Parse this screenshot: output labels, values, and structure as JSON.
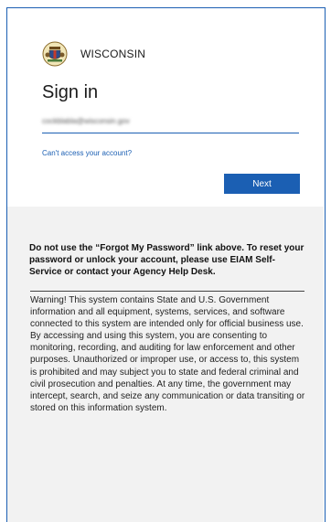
{
  "brand": {
    "name": "WISCONSIN",
    "logo_icon": "wisconsin-seal-icon"
  },
  "signin": {
    "title": "Sign in",
    "email_value": "cockblabla@wisconsin.gov",
    "help_link": "Can't access your account?",
    "next_label": "Next"
  },
  "notice": {
    "bold_text": "Do not use the “Forgot My Password” link above. To reset your password or unlock your account, please use EIAM Self-Service or contact your Agency Help Desk.",
    "warning_text": "Warning! This system contains State and U.S. Government information and all equipment, systems, services, and software connected to this system are intended only for official business use. By accessing and using this system, you are consenting to monitoring, recording, and auditing for law enforcement and other purposes. Unauthorized or improper use, or access to, this system is prohibited and may subject you to state and federal criminal and civil prosecution and penalties. At any time, the government may intercept, search, and seize any communication or data transiting or stored on this information system."
  },
  "colors": {
    "accent": "#1b5fb3",
    "notice_bg": "#f2f2f2"
  }
}
